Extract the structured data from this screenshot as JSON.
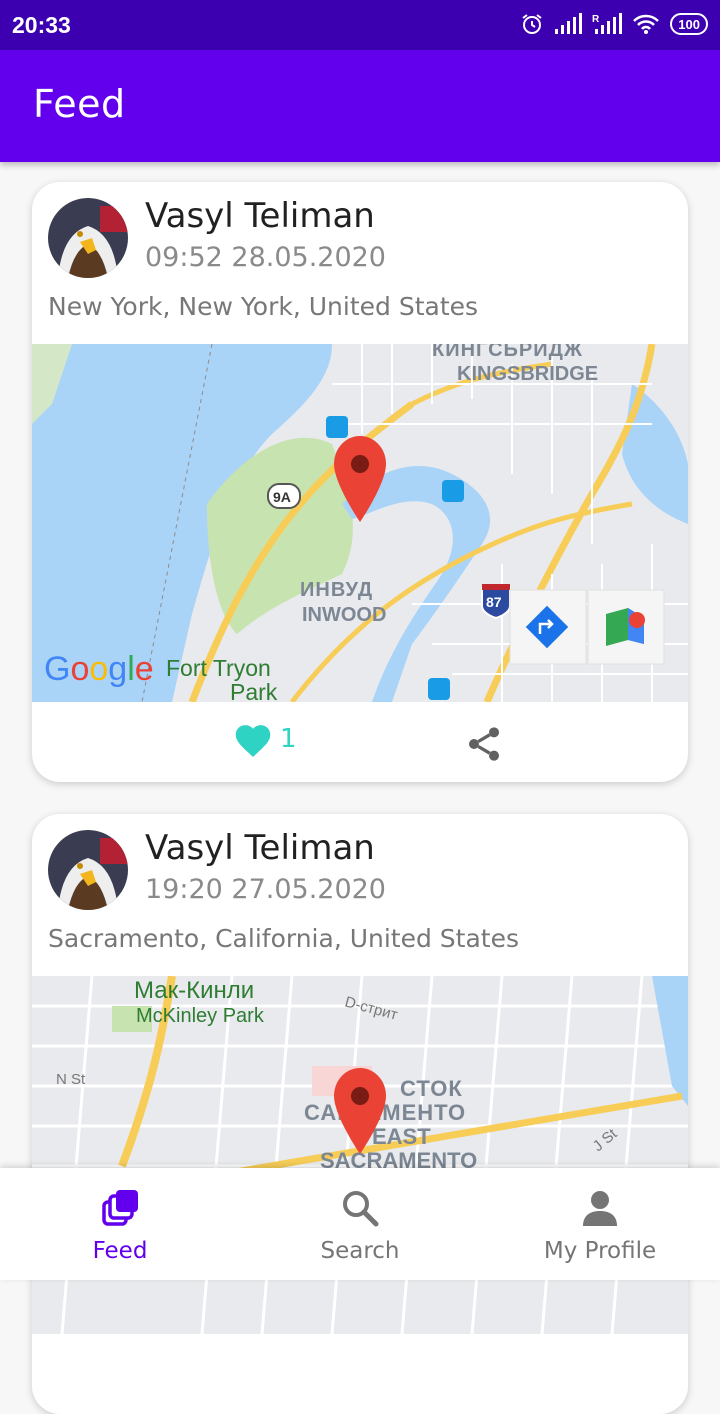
{
  "status_bar": {
    "time": "20:33",
    "battery": "100"
  },
  "app_bar": {
    "title": "Feed"
  },
  "posts": [
    {
      "user": "Vasyl Teliman",
      "datetime": "09:52 28.05.2020",
      "location": "New York, New York, United States",
      "likes": "1",
      "map_labels": {
        "cyrillic_top": "КИНГСЬРИДЖ",
        "kingsbridge": "KINGSBRIDGE",
        "inwood_cyr": "ИНВУД",
        "inwood": "INWOOD",
        "fort_tryon_1": "Fort Tryon",
        "fort_tryon_2": "Park",
        "route_9a": "9A",
        "route_87": "87",
        "google": "Google"
      }
    },
    {
      "user": "Vasyl Teliman",
      "datetime": "19:20 27.05.2020",
      "location": "Sacramento, California, United States",
      "map_labels": {
        "mckinley_cyr": "Мак-Кинли",
        "mckinley": "McKinley Park",
        "d_street": "D-стрит",
        "n_st": "N St",
        "east_cyr": "СТОК",
        "sacramento_cyr": "САКРАМЕНТО",
        "east": "EAST",
        "sacramento": "SACRAMENTO",
        "j_st": "J St"
      }
    }
  ],
  "bottom_nav": {
    "items": [
      {
        "label": "Feed"
      },
      {
        "label": "Search"
      },
      {
        "label": "My Profile"
      }
    ]
  },
  "colors": {
    "primary": "#6200ee",
    "status_bar": "#3d00b0",
    "like": "#2ed3c4"
  }
}
